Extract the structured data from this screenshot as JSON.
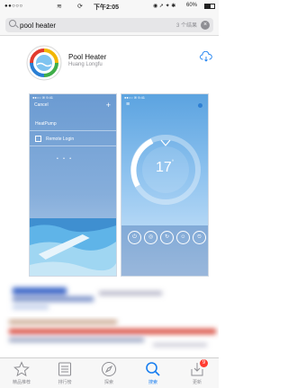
{
  "status_bar": {
    "signal": "●●○○○",
    "time": "下午2:05",
    "battery_percent": "60%",
    "battery_level": 0.6
  },
  "search": {
    "query": "pool heater",
    "result_count": "3 个结果"
  },
  "app": {
    "name": "Pool Heater",
    "developer": "Huang Longfu",
    "download_icon": "cloud-download-icon"
  },
  "screenshot_1": {
    "nav_back": "Cancel",
    "rows": [
      "HeatPump",
      "Remote Login"
    ]
  },
  "screenshot_2": {
    "temperature": "17",
    "degree_symbol": "°",
    "buttons": [
      "⏻",
      "◎",
      "↻",
      "☺",
      "⏲"
    ]
  },
  "tab_bar": {
    "tabs": [
      {
        "label": "精品推荐",
        "icon": "star-icon"
      },
      {
        "label": "排行榜",
        "icon": "list-icon"
      },
      {
        "label": "探索",
        "icon": "compass-icon"
      },
      {
        "label": "搜索",
        "icon": "search-icon"
      },
      {
        "label": "更新",
        "icon": "download-tray-icon"
      }
    ],
    "active_index": 3,
    "update_badge": "9"
  },
  "colors": {
    "accent": "#1a7ff0",
    "badge": "#ff3b30"
  }
}
